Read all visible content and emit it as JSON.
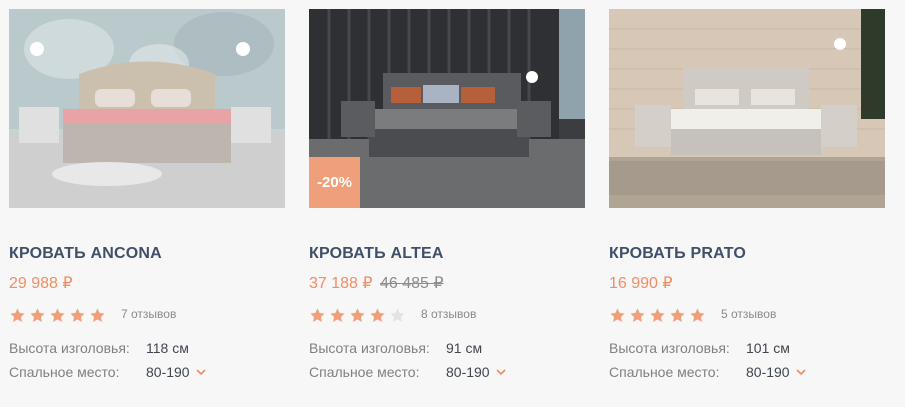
{
  "products": [
    {
      "title": "Кровать Ancona",
      "price": "29 988 ₽",
      "old_price": "",
      "badge": "",
      "rating": 5,
      "reviews": "7 отзывов",
      "spec_headboard_label": "Высота изголовья:",
      "spec_headboard_value": "118 см",
      "spec_size_label": "Спальное место:",
      "spec_size_value": "80-190"
    },
    {
      "title": "Кровать Altea",
      "price": "37 188 ₽",
      "old_price": "46 485 ₽",
      "badge": "-20%",
      "rating": 4,
      "reviews": "8 отзывов",
      "spec_headboard_label": "Высота изголовья:",
      "spec_headboard_value": "91 см",
      "spec_size_label": "Спальное место:",
      "spec_size_value": "80-190"
    },
    {
      "title": "Кровать Prato",
      "price": "16 990 ₽",
      "old_price": "",
      "badge": "",
      "rating": 5,
      "reviews": "5 отзывов",
      "spec_headboard_label": "Высота изголовья:",
      "spec_headboard_value": "101 см",
      "spec_size_label": "Спальное место:",
      "spec_size_value": "80-190"
    }
  ],
  "colors": {
    "accent": "#ef8d63",
    "title": "#3f5068",
    "star_filled": "#ef9f79",
    "star_empty": "#e3e3e3",
    "badge_bg": "#ef9f79"
  },
  "icons": {
    "star": "star-icon",
    "chevron": "chevron-down-icon"
  }
}
